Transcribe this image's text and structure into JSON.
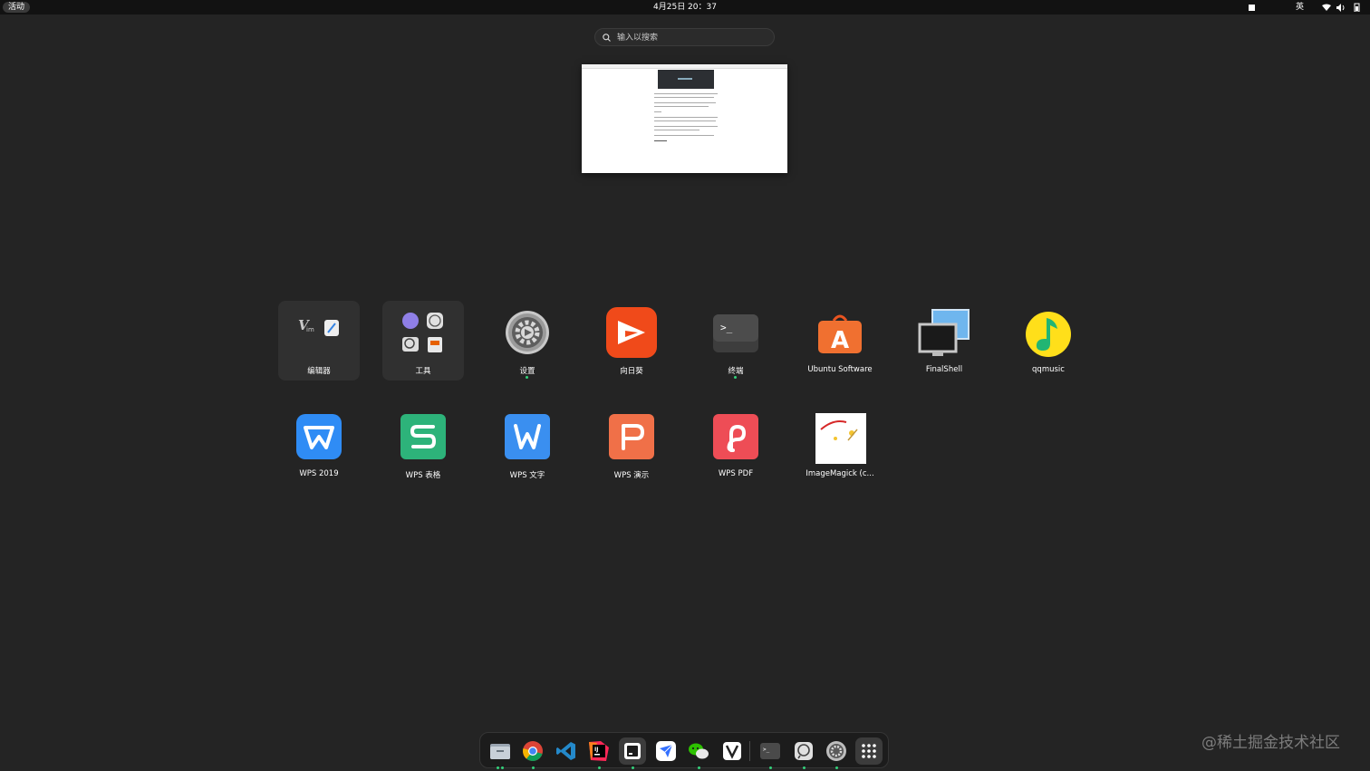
{
  "topbar": {
    "activities": "活动",
    "clock": "4月25日  20：37",
    "input_method": "英"
  },
  "search": {
    "placeholder": "输入以搜索"
  },
  "apps_row1": [
    {
      "label": "编辑器"
    },
    {
      "label": "工具"
    },
    {
      "label": "设置"
    },
    {
      "label": "向日葵"
    },
    {
      "label": "终端"
    },
    {
      "label": "Ubuntu Software"
    },
    {
      "label": "FinalShell"
    },
    {
      "label": "qqmusic"
    }
  ],
  "apps_row2": [
    {
      "label": "WPS 2019"
    },
    {
      "label": "WPS 表格"
    },
    {
      "label": "WPS 文字"
    },
    {
      "label": "WPS 演示"
    },
    {
      "label": "WPS PDF"
    },
    {
      "label": "ImageMagick (c..."
    }
  ],
  "dock": {
    "items": [
      "files-icon",
      "chrome-icon",
      "vscode-icon",
      "intellij-icon",
      "typora-icon",
      "feishu-icon",
      "wechat-icon",
      "vim-icon",
      "terminal-icon",
      "screenshot-icon",
      "settings-icon",
      "show-apps-icon"
    ],
    "accent_running": "#33d17a"
  },
  "watermark": "@稀土掘金技术社区",
  "colors": {
    "background": "#242424",
    "topbar": "#121212"
  }
}
